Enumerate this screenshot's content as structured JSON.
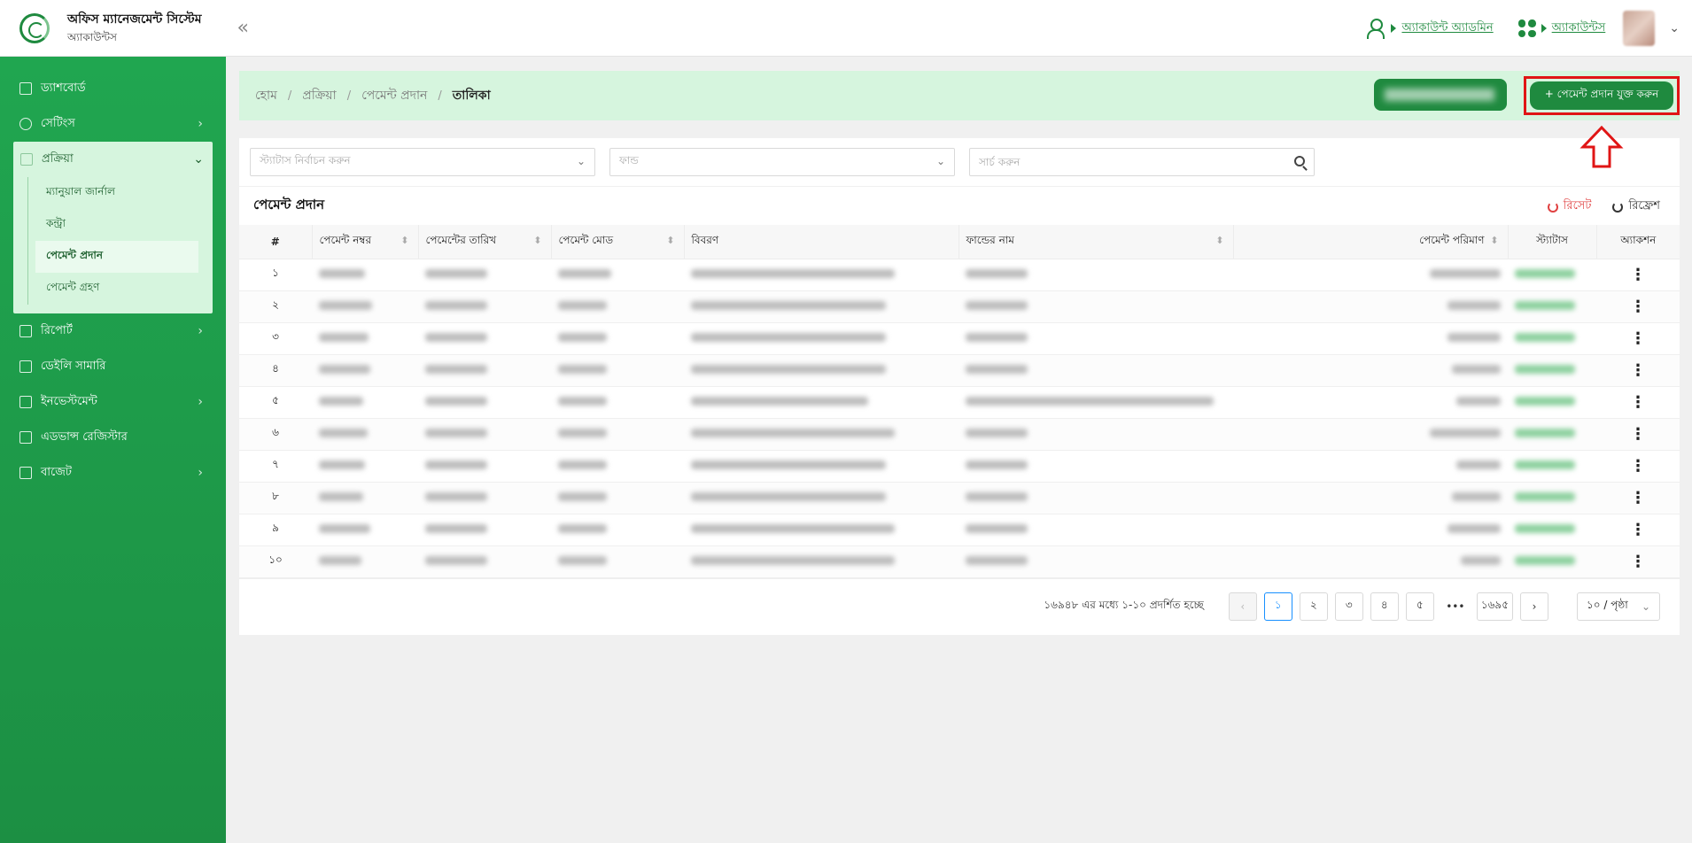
{
  "app": {
    "title": "অফিস ম্যানেজমেন্ট সিস্টেম",
    "subtitle": "অ্যাকাউন্টস",
    "collapse_icon": "«"
  },
  "header": {
    "admin_link": "অ্যাকাউন্ট অ্যাডমিন",
    "accounts_link": "অ্যাকাউন্টস"
  },
  "sidebar": {
    "items": [
      {
        "label": "ড্যাশবোর্ড",
        "icon": "dashboard-icon",
        "has_arrow": false
      },
      {
        "label": "সেটিংস",
        "icon": "gear-icon",
        "has_arrow": true
      },
      {
        "label": "প্রক্রিয়া",
        "icon": "process-icon",
        "has_arrow": true
      },
      {
        "label": "রিপোর্ট",
        "icon": "report-icon",
        "has_arrow": true
      },
      {
        "label": "ডেইলি সামারি",
        "icon": "summary-icon",
        "has_arrow": false
      },
      {
        "label": "ইনভেস্টমেন্ট",
        "icon": "investment-icon",
        "has_arrow": true
      },
      {
        "label": "এডভান্স রেজিস্টার",
        "icon": "register-icon",
        "has_arrow": false
      },
      {
        "label": "বাজেট",
        "icon": "budget-icon",
        "has_arrow": true
      }
    ],
    "sub_items": [
      "ম্যানুয়াল জার্নাল",
      "কন্ট্রা",
      "পেমেন্ট প্রদান",
      "পেমেন্ট গ্রহণ"
    ]
  },
  "breadcrumb": {
    "items": [
      "হোম",
      "প্রক্রিয়া",
      "পেমেন্ট প্রদান"
    ],
    "current": "তালিকা",
    "separator": "/"
  },
  "actions": {
    "add_payment": "+ পেমেন্ট প্রদান যুক্ত করুন"
  },
  "filters": {
    "status_placeholder": "স্ট্যাটাস নির্বাচন করুন",
    "fund_placeholder": "ফান্ড",
    "search_placeholder": "সার্চ করুন"
  },
  "table": {
    "title": "পেমেন্ট প্রদান",
    "reset": "রিসেট",
    "refresh": "রিফ্রেশ",
    "columns": [
      "#",
      "পেমেন্ট নম্বর",
      "পেমেন্টের তারিখ",
      "পেমেন্ট মোড",
      "বিবরণ",
      "ফান্ডের নাম",
      "পেমেন্ট পরিমাণ",
      "স্ট্যাটাস",
      "অ্যাকশন"
    ],
    "row_numbers": [
      "১",
      "২",
      "৩",
      "৪",
      "৫",
      "৬",
      "৭",
      "৮",
      "৯",
      "১০"
    ]
  },
  "pagination": {
    "info": "১৬৯৪৮ এর মধ্যে ১-১০ প্রদর্শিত হচ্ছে",
    "pages": [
      "১",
      "২",
      "৩",
      "৪",
      "৫"
    ],
    "ellipsis": "•••",
    "last_page": "১৬৯৫",
    "per_page": "১০ / পৃষ্ঠা"
  },
  "colors": {
    "brand_green": "#1f8a3f",
    "highlight_red": "#e01515",
    "breadcrumb_bg": "#d6f5de"
  }
}
